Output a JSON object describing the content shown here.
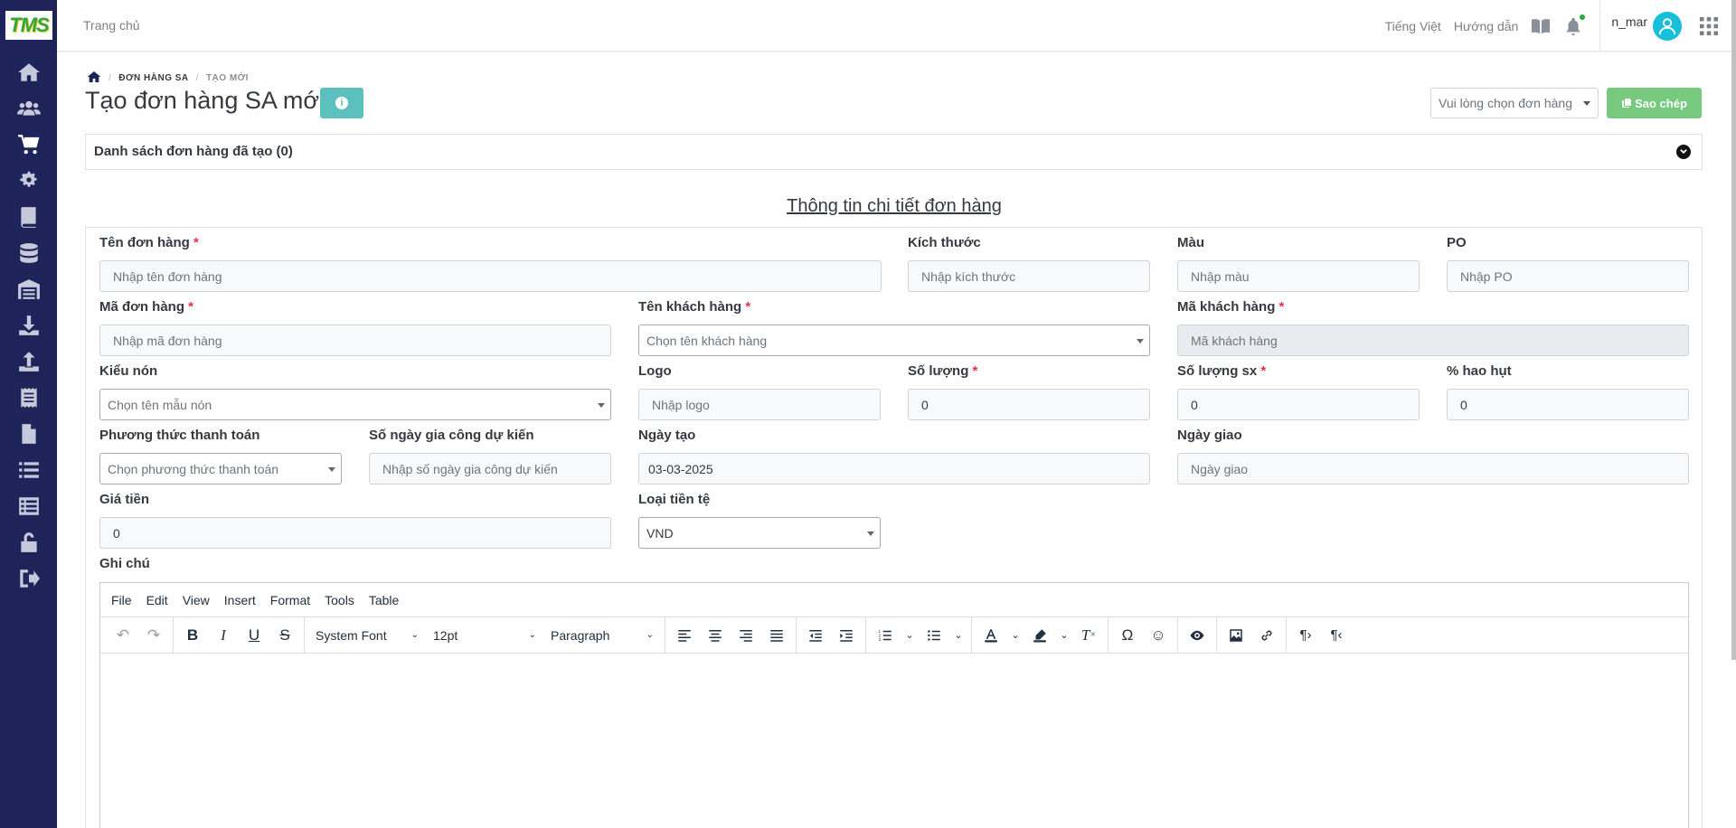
{
  "app": {
    "logo_text": "TMS",
    "brand_color": "#1e2459",
    "accent_color": "#2aa845"
  },
  "topbar": {
    "home_link": "Trang chủ",
    "language": "Tiếng Việt",
    "help": "Hướng dẫn",
    "username": "n_mar"
  },
  "sidebar": {
    "icons": [
      "home-icon",
      "users-icon",
      "cart-icon",
      "cogs-icon",
      "book-icon",
      "database-icon",
      "warehouse-icon",
      "download-icon",
      "upload-icon",
      "receipt-icon",
      "file-icon",
      "list-icon",
      "table-list-icon",
      "lock-icon",
      "logout-icon"
    ],
    "active_index": 2
  },
  "breadcrumb": {
    "items": [
      "ĐƠN HÀNG SA",
      "TẠO MỚI"
    ]
  },
  "page": {
    "title": "Tạo đơn hàng SA mới",
    "copy_select_placeholder": "Vui lòng chọn đơn hàng",
    "copy_button": "Sao chép",
    "created_list": "Danh sách đơn hàng đã tạo (0)",
    "section_title": "Thông tin chi tiết đơn hàng"
  },
  "form": {
    "order_name": {
      "label": "Tên đơn hàng",
      "required": "*",
      "placeholder": "Nhập tên đơn hàng"
    },
    "size": {
      "label": "Kích thước",
      "placeholder": "Nhập kích thước"
    },
    "color": {
      "label": "Màu",
      "placeholder": "Nhập màu"
    },
    "po": {
      "label": "PO",
      "placeholder": "Nhập PO"
    },
    "order_code": {
      "label": "Mã đơn hàng",
      "required": "*",
      "placeholder": "Nhập mã đơn hàng"
    },
    "customer_name": {
      "label": "Tên khách hàng",
      "required": "*",
      "placeholder": "Chọn tên khách hàng"
    },
    "customer_code": {
      "label": "Mã khách hàng",
      "required": "*",
      "placeholder": "Mã khách hàng"
    },
    "hat_style": {
      "label": "Kiểu nón",
      "placeholder": "Chọn tên mẫu nón"
    },
    "logo": {
      "label": "Logo",
      "placeholder": "Nhập logo"
    },
    "quantity": {
      "label": "Số lượng",
      "required": "*",
      "value": "0"
    },
    "prod_quantity": {
      "label": "Số lượng sx",
      "required": "*",
      "value": "0"
    },
    "loss": {
      "label": "% hao hụt",
      "value": "0"
    },
    "payment": {
      "label": "Phương thức thanh toán",
      "placeholder": "Chọn phương thức thanh toán"
    },
    "processing_days": {
      "label": "Số ngày gia công dự kiến",
      "placeholder": "Nhập số ngày gia công dự kiến"
    },
    "created_date": {
      "label": "Ngày tạo",
      "value": "03-03-2025"
    },
    "delivery_date": {
      "label": "Ngày giao",
      "placeholder": "Ngày giao"
    },
    "price": {
      "label": "Giá tiền",
      "value": "0"
    },
    "currency": {
      "label": "Loại tiền tệ",
      "value": "VND"
    },
    "note": {
      "label": "Ghi chú"
    }
  },
  "editor": {
    "menu": [
      "File",
      "Edit",
      "View",
      "Insert",
      "Format",
      "Tools",
      "Table"
    ],
    "font_family": "System Font",
    "font_size": "12pt",
    "block_format": "Paragraph"
  }
}
